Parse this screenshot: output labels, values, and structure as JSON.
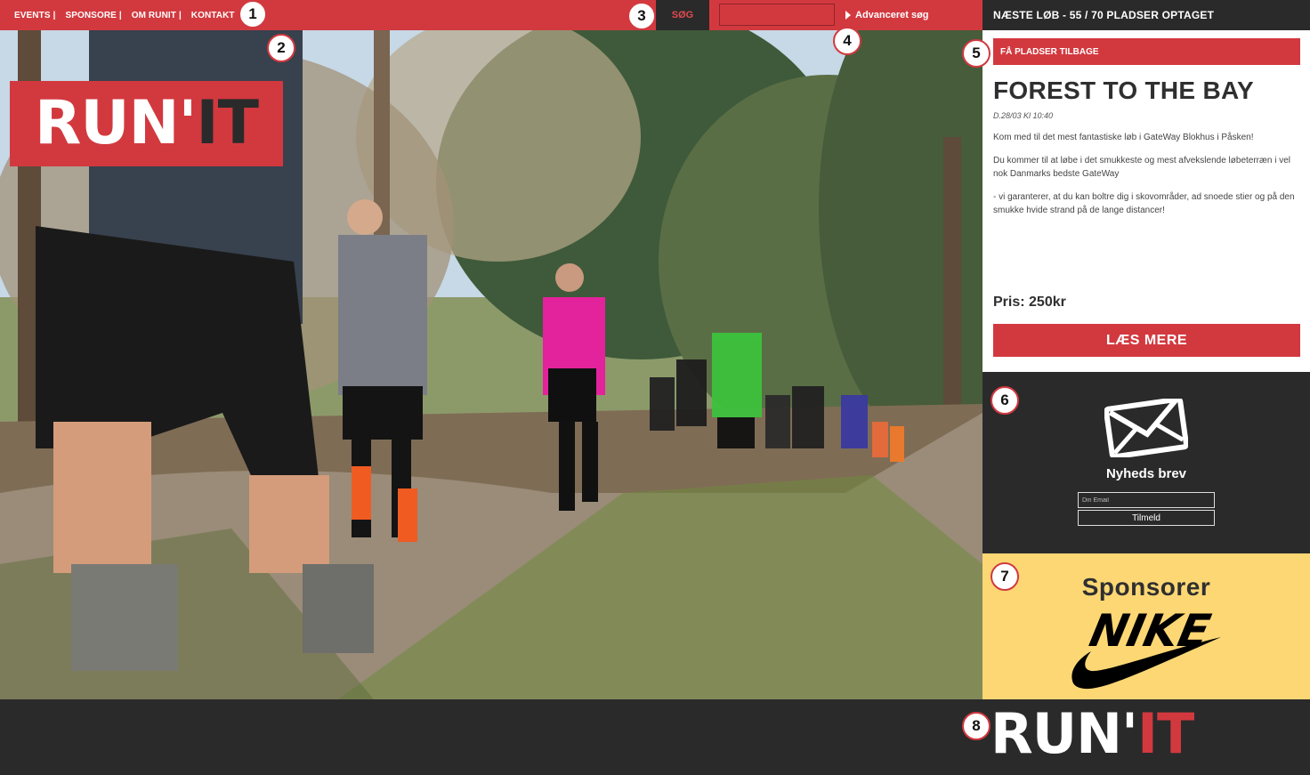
{
  "nav": {
    "items": [
      {
        "label": "EVENTS"
      },
      {
        "label": "SPONSORE"
      },
      {
        "label": "OM RUNIT"
      },
      {
        "label": "KONTAKT"
      }
    ],
    "separator": "|"
  },
  "search": {
    "label": "SØG",
    "placeholder": "",
    "advanced_label": "Advanceret søg"
  },
  "logo": {
    "part1": "RUN'",
    "part2": "IT"
  },
  "next_race": {
    "header": "NÆSTE LØB - 55 / 70 PLADSER OPTAGET",
    "badge": "FÅ PLADSER TILBAGE",
    "title": "FOREST TO THE BAY",
    "date": "D.28/03 Kl 10:40",
    "paragraphs": [
      "Kom med til det mest fantastiske løb i GateWay Blokhus i Påsken!",
      "Du kommer til at løbe i det smukkeste og mest afvekslende løbeterræn i vel nok Danmarks bedste GateWay",
      "- vi garanterer, at du kan boltre dig i skovområder, ad snoede stier og på den smukke hvide strand på de lange distancer!"
    ],
    "price": "Pris: 250kr",
    "read_more": "LÆS MERE"
  },
  "newsletter": {
    "title": "Nyheds brev",
    "email_placeholder": "Din Email",
    "submit_label": "Tilmeld",
    "icon": "envelope-icon"
  },
  "sponsor": {
    "title": "Sponsorer",
    "brand": "NIKE"
  },
  "footer": {
    "logo_part1": "RUN'",
    "logo_part2": "IT"
  },
  "markers": [
    "1",
    "2",
    "3",
    "4",
    "5",
    "6",
    "7",
    "8"
  ],
  "colors": {
    "brand_red": "#d2393f",
    "dark": "#2a2a2a",
    "sponsor_yellow": "#fcd774"
  }
}
